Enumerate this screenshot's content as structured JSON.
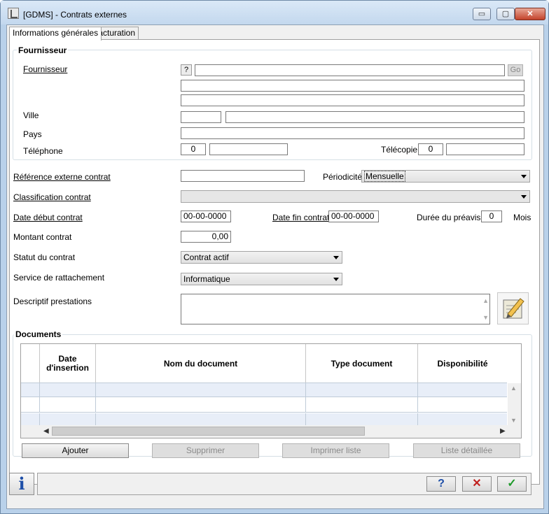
{
  "window": {
    "title": "[GDMS] - Contrats externes",
    "minimize": "▭",
    "maximize": "▢",
    "close": "✕"
  },
  "tabs": [
    "Informations générales",
    "Facturation"
  ],
  "fournisseur": {
    "group_title": "Fournisseur",
    "label": "Fournisseur",
    "lookup_btn": "?",
    "go_btn": "Go",
    "ville_label": "Ville",
    "pays_label": "Pays",
    "telephone_label": "Téléphone",
    "telephone_code": "0",
    "telecopie_label": "Télécopie",
    "telecopie_code": "0"
  },
  "contract": {
    "ref_label": "Référence externe contrat",
    "periodicite_label": "Périodicité",
    "periodicite_value": "Mensuelle",
    "classification_label": "Classification contrat",
    "date_debut_label": "Date début contrat",
    "date_debut_value": "00-00-0000",
    "date_fin_label": "Date fin contrat",
    "date_fin_value": "00-00-0000",
    "preavis_label": "Durée du préavis",
    "preavis_value": "0",
    "preavis_unit": "Mois",
    "montant_label": "Montant contrat",
    "montant_value": "0,00",
    "statut_label": "Statut du contrat",
    "statut_value": "Contrat actif",
    "service_label": "Service de rattachement",
    "service_value": "Informatique",
    "descriptif_label": "Descriptif prestations"
  },
  "documents": {
    "group_title": "Documents",
    "columns": [
      "Date d'insertion",
      "Nom du document",
      "Type document",
      "Disponibilité"
    ],
    "buttons": {
      "ajouter": "Ajouter",
      "supprimer": "Supprimer",
      "imprimer": "Imprimer liste",
      "liste": "Liste détaillée"
    }
  },
  "footer": {
    "help": "?",
    "cancel": "✕",
    "ok": "✓",
    "info": "i"
  },
  "colors": {
    "cancel": "#c0201e",
    "ok": "#1e9a2a",
    "help": "#1e4fa8",
    "info": "#1e4fa8"
  }
}
